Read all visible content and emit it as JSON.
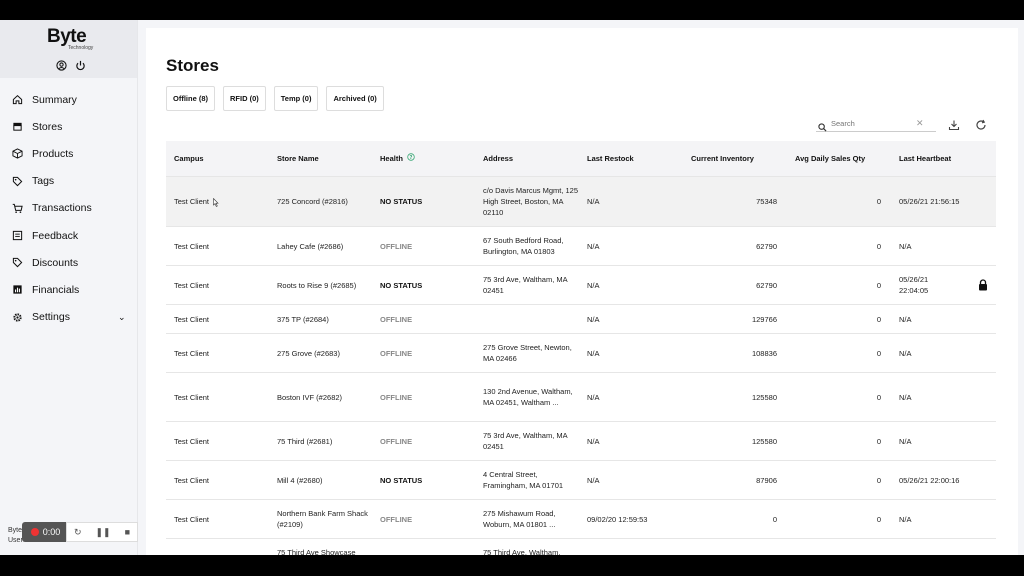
{
  "brand": {
    "name": "Byte",
    "sub": "Technology"
  },
  "sidebar": {
    "items": [
      {
        "label": "Summary",
        "icon": "home-icon"
      },
      {
        "label": "Stores",
        "icon": "store-icon"
      },
      {
        "label": "Products",
        "icon": "box-icon"
      },
      {
        "label": "Tags",
        "icon": "tag-icon"
      },
      {
        "label": "Transactions",
        "icon": "cart-icon"
      },
      {
        "label": "Feedback",
        "icon": "feedback-icon"
      },
      {
        "label": "Discounts",
        "icon": "discount-tag-icon"
      },
      {
        "label": "Financials",
        "icon": "chart-icon"
      },
      {
        "label": "Settings",
        "icon": "gear-icon"
      }
    ]
  },
  "recorder": {
    "user_top": "Byte",
    "user_bottom": "User",
    "timer": "0:00"
  },
  "page": {
    "title": "Stores"
  },
  "filters": [
    "Offline (8)",
    "RFID (0)",
    "Temp (0)",
    "Archived (0)"
  ],
  "search": {
    "placeholder": "Search"
  },
  "table": {
    "headers": [
      "Campus",
      "Store Name",
      "Health",
      "Address",
      "Last Restock",
      "Current Inventory",
      "Avg Daily Sales Qty",
      "Last Heartbeat"
    ],
    "rows": [
      {
        "campus": "Test Client",
        "store": "725 Concord (#2816)",
        "health": "NO STATUS",
        "address": "c/o Davis Marcus Mgmt, 125 High Street, Boston, MA 02110",
        "restock": "N/A",
        "inventory": "75348",
        "sales": "0",
        "heartbeat": "05/26/21 21:56:15"
      },
      {
        "campus": "Test Client",
        "store": "Lahey Cafe (#2686)",
        "health": "OFFLINE",
        "address": "67 South Bedford Road, Burlington, MA 01803",
        "restock": "N/A",
        "inventory": "62790",
        "sales": "0",
        "heartbeat": "N/A"
      },
      {
        "campus": "Test Client",
        "store": "Roots to Rise 9 (#2685)",
        "health": "NO STATUS",
        "address": "75 3rd Ave, Waltham, MA 02451",
        "restock": "N/A",
        "inventory": "62790",
        "sales": "0",
        "heartbeat": "05/26/21 22:04:05"
      },
      {
        "campus": "Test Client",
        "store": "375 TP (#2684)",
        "health": "OFFLINE",
        "address": "",
        "restock": "N/A",
        "inventory": "129766",
        "sales": "0",
        "heartbeat": "N/A"
      },
      {
        "campus": "Test Client",
        "store": "275 Grove (#2683)",
        "health": "OFFLINE",
        "address": "275 Grove Street, Newton, MA 02466",
        "restock": "N/A",
        "inventory": "108836",
        "sales": "0",
        "heartbeat": "N/A"
      },
      {
        "campus": "Test Client",
        "store": "Boston IVF (#2682)",
        "health": "OFFLINE",
        "address": "130 2nd Avenue, Waltham, MA 02451, Waltham ...",
        "restock": "N/A",
        "inventory": "125580",
        "sales": "0",
        "heartbeat": "N/A"
      },
      {
        "campus": "Test Client",
        "store": "75 Third (#2681)",
        "health": "OFFLINE",
        "address": "75 3rd Ave, Waltham, MA 02451",
        "restock": "N/A",
        "inventory": "125580",
        "sales": "0",
        "heartbeat": "N/A"
      },
      {
        "campus": "Test Client",
        "store": "Mill 4 (#2680)",
        "health": "NO STATUS",
        "address": "4 Central Street, Framingham, MA 01701",
        "restock": "N/A",
        "inventory": "87906",
        "sales": "0",
        "heartbeat": "05/26/21 22:00:16"
      },
      {
        "campus": "Test Client",
        "store": "Northern Bank Farm Shack (#2109)",
        "health": "OFFLINE",
        "address": "275 Mishawum Road, Woburn, MA 01801 ...",
        "restock": "09/02/20 12:59:53",
        "inventory": "0",
        "sales": "0",
        "heartbeat": "N/A"
      },
      {
        "campus": "",
        "store": "75 Third Ave Showcase",
        "health": "",
        "address": "75 Third Ave, Waltham,",
        "restock": "",
        "inventory": "",
        "sales": "",
        "heartbeat": ""
      }
    ]
  },
  "colors": {
    "health_info": "#3aa876",
    "offline": "#888888",
    "sidebar_bg": "#f4f5f8"
  }
}
